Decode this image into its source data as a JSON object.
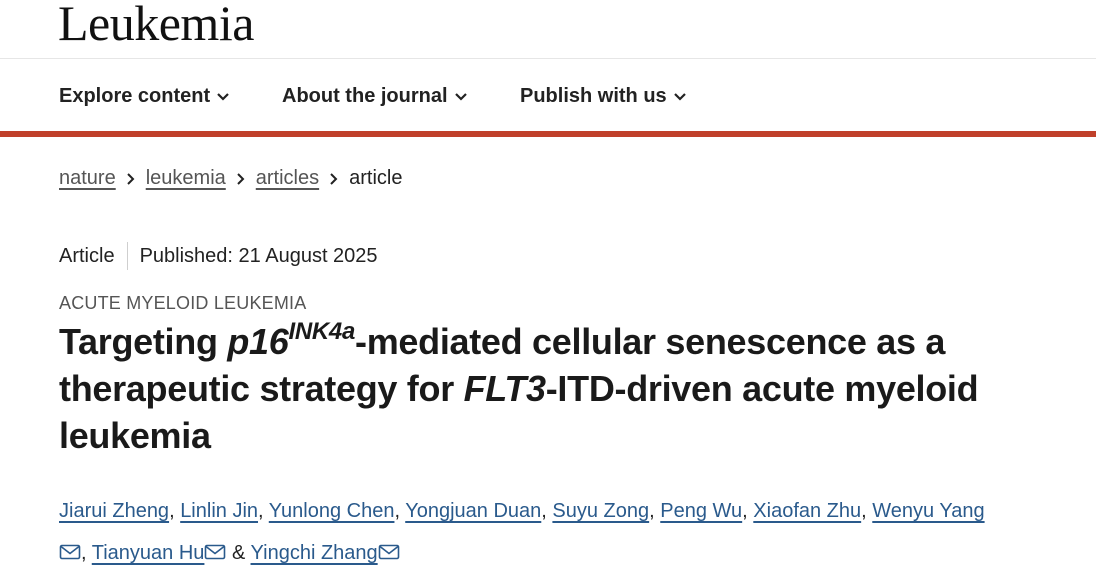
{
  "header": {
    "journal_name": "Leukemia"
  },
  "nav": {
    "items": [
      {
        "label": "Explore content"
      },
      {
        "label": "About the journal"
      },
      {
        "label": "Publish with us"
      }
    ]
  },
  "breadcrumb": [
    "nature",
    "leukemia",
    "articles",
    "article"
  ],
  "article": {
    "type": "Article",
    "published": "Published: 21 August 2025",
    "subject": "ACUTE MYELOID LEUKEMIA",
    "title": {
      "p1": "Targeting ",
      "p16": "p16",
      "ink": "INK4a",
      "p2": "-mediated cellular senescence as a therapeutic strategy for ",
      "flt3": "FLT3",
      "p3": "-ITD-driven acute myeloid leukemia"
    },
    "authors": [
      "Jiarui Zheng",
      "Linlin Jin",
      "Yunlong Chen",
      "Yongjuan Duan",
      "Suyu Zong",
      "Peng Wu",
      "Xiaofan Zhu",
      "Wenyu Yang",
      "Tianyuan Hu",
      "Yingchi Zhang"
    ],
    "separators": {
      "comma": ",",
      "amp": "&"
    }
  },
  "colors": {
    "accent": "#c0402a",
    "link": "#2a5a8c",
    "breadcrumb_link": "#555555"
  },
  "icons": {
    "nav_chevron": "chevron-down-icon",
    "breadcrumb_sep": "chevron-right-icon",
    "author_contact": "envelope-icon"
  }
}
